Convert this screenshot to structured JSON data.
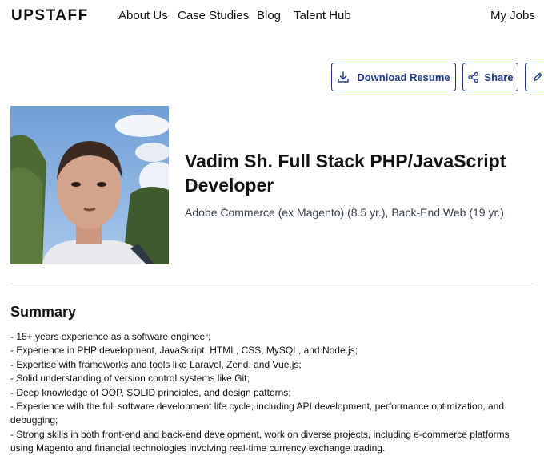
{
  "nav": {
    "logo": "UPSTAFF",
    "links": [
      "About Us",
      "Case Studies",
      "Blog",
      "Talent Hub"
    ],
    "my_jobs": "My Jobs"
  },
  "actions": {
    "download_label": "Download Resume",
    "share_label": "Share"
  },
  "profile": {
    "title": "Vadim Sh. Full Stack PHP/JavaScript Developer",
    "subtitle": "Adobe Commerce (ex Magento) (8.5 yr.), Back-End Web (19 yr.)"
  },
  "summary": {
    "heading": "Summary",
    "lines": [
      "- 15+ years experience as a software engineer;",
      "- Experience in PHP development, JavaScript, HTML, CSS, MySQL, and Node.js;",
      "- Expertise with frameworks and tools like Laravel, Zend, and Vue.js;",
      "- Solid understanding of version control systems like Git;",
      "- Deep knowledge of OOP, SOLID principles, and design patterns;",
      "- Experience with the full software development life cycle, including API development, performance optimization, and debugging;",
      "- Strong skills in both front-end and back-end development, work on diverse projects, including e-commerce platforms using Magento and financial technologies involving real-time currency exchange trading."
    ]
  },
  "colors": {
    "accent": "#1e3a8a",
    "divider": "#d9d9d9"
  }
}
